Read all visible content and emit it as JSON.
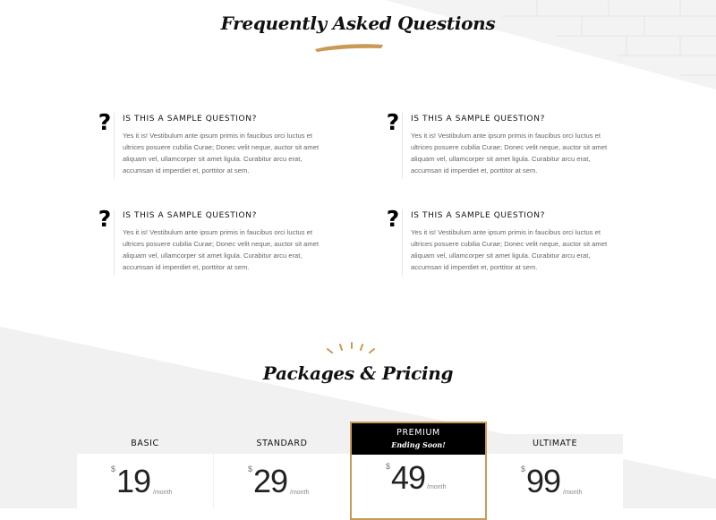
{
  "faq": {
    "title": "Frequently Asked Questions",
    "items": [
      {
        "question": "IS THIS A SAMPLE QUESTION?",
        "answer": "Yes it is! Vestibulum ante ipsum primis in faucibus orci luctus et ultrices posuere cubilia Curae; Donec velit neque, auctor sit amet aliquam vel, ullamcorper sit amet ligula. Curabitur arcu erat, accumsan id imperdiet et, porttitor at sem."
      },
      {
        "question": "IS THIS A SAMPLE QUESTION?",
        "answer": "Yes it is! Vestibulum ante ipsum primis in faucibus orci luctus et ultrices posuere cubilia Curae; Donec velit neque, auctor sit amet aliquam vel, ullamcorper sit amet ligula. Curabitur arcu erat, accumsan id imperdiet et, porttitor at sem."
      },
      {
        "question": "IS THIS A SAMPLE QUESTION?",
        "answer": "Yes it is! Vestibulum ante ipsum primis in faucibus orci luctus et ultrices posuere cubilia Curae; Donec velit neque, auctor sit amet aliquam vel, ullamcorper sit amet ligula. Curabitur arcu erat, accumsan id imperdiet et, porttitor at sem."
      },
      {
        "question": "IS THIS A SAMPLE QUESTION?",
        "answer": "Yes it is! Vestibulum ante ipsum primis in faucibus orci luctus et ultrices posuere cubilia Curae; Donec velit neque, auctor sit amet aliquam vel, ullamcorper sit amet ligula. Curabitur arcu erat, accumsan id imperdiet et, porttitor at sem."
      }
    ],
    "icon": "question-mark-icon"
  },
  "pricing": {
    "title": "Packages & Pricing",
    "plans": [
      {
        "name": "BASIC",
        "currency": "$",
        "amount": "19",
        "period": "/month"
      },
      {
        "name": "STANDARD",
        "currency": "$",
        "amount": "29",
        "period": "/month"
      },
      {
        "name": "PREMIUM",
        "badge": "Ending Soon!",
        "currency": "$",
        "amount": "49",
        "period": "/month"
      },
      {
        "name": "ULTIMATE",
        "currency": "$",
        "amount": "99",
        "period": "/month"
      }
    ]
  },
  "colors": {
    "accent_gold": "#c99a55",
    "background_gray": "#f1f1f1",
    "premium_header": "#000000"
  }
}
